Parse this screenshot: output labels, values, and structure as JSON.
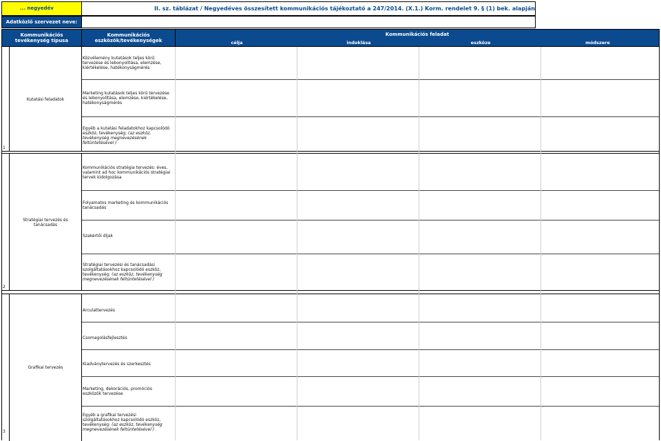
{
  "header": {
    "period_label": "... negyedév",
    "title": "II. sz. táblázat / Negyedéves összesített kommunikációs tájékoztató a 247/2014. (X.1.) Korm. rendelet 9. § (1) bek. alapján",
    "org_label": "Adatközlő szervezet neve:"
  },
  "columns": {
    "type": "Kommunikációs tevékenység típusa",
    "tools": "Kommunikációs eszközök/tevékenységek",
    "task": "Kommunikációs feladat",
    "sub": [
      "célja",
      "indoklása",
      "eszköze",
      "módszere"
    ]
  },
  "sections": [
    {
      "number": "1",
      "type": "Kutatási feladatok",
      "items": [
        {
          "text": "Közvélemény kutatások teljes körű tervezése és lebonyolítása, elemzése, kiértékelése, hatékonyságmérés",
          "note": ""
        },
        {
          "text": "Marketing kutatások teljes körű tervezése és lebonyolítása, elemzése, kiértékelése, hatékonyságmérés",
          "note": ""
        },
        {
          "text": "Egyéb a kutatási feladatokhoz kapcsolódó eszköz, tevékenység: ",
          "note": "(az eszköz, tevékenység megnevezésének feltüntetésével )"
        }
      ]
    },
    {
      "number": "2",
      "type": "Stratégiai tervezés és tanácsadás",
      "items": [
        {
          "text": "Kommunikációs stratégia tervezés: éves, valamint ad hoc kommunikációs stratégiai tervek kidolgozása",
          "note": ""
        },
        {
          "text": "Folyamatos marketing és kommunikációs tanácsadás",
          "note": ""
        },
        {
          "text": "Szakértői díjak",
          "note": ""
        },
        {
          "text": "Stratégiai tervezési és tanácsadási szolgáltatásokhoz kapcsolódó eszköz, tevékenység: ",
          "note": "(az eszköz, tevékenység megnevezésének feltüntetésével )"
        }
      ]
    },
    {
      "number": "3",
      "type": "Grafikai tervezés",
      "items": [
        {
          "text": "Arculattervezés",
          "note": ""
        },
        {
          "text": "Csomagolásfejlesztés",
          "note": ""
        },
        {
          "text": "Kiadványtervezés és szerkesztés",
          "note": ""
        },
        {
          "text": "Marketing, dekorációs, promóciós eszközök tervezése",
          "note": ""
        },
        {
          "text": "Egyéb a grafikai tervezési szolgáltatásokhoz kapcsolódó eszköz, tevékenység: ",
          "note": "(az eszköz, tevékenység megnevezésének feltüntetésével )"
        }
      ]
    }
  ]
}
